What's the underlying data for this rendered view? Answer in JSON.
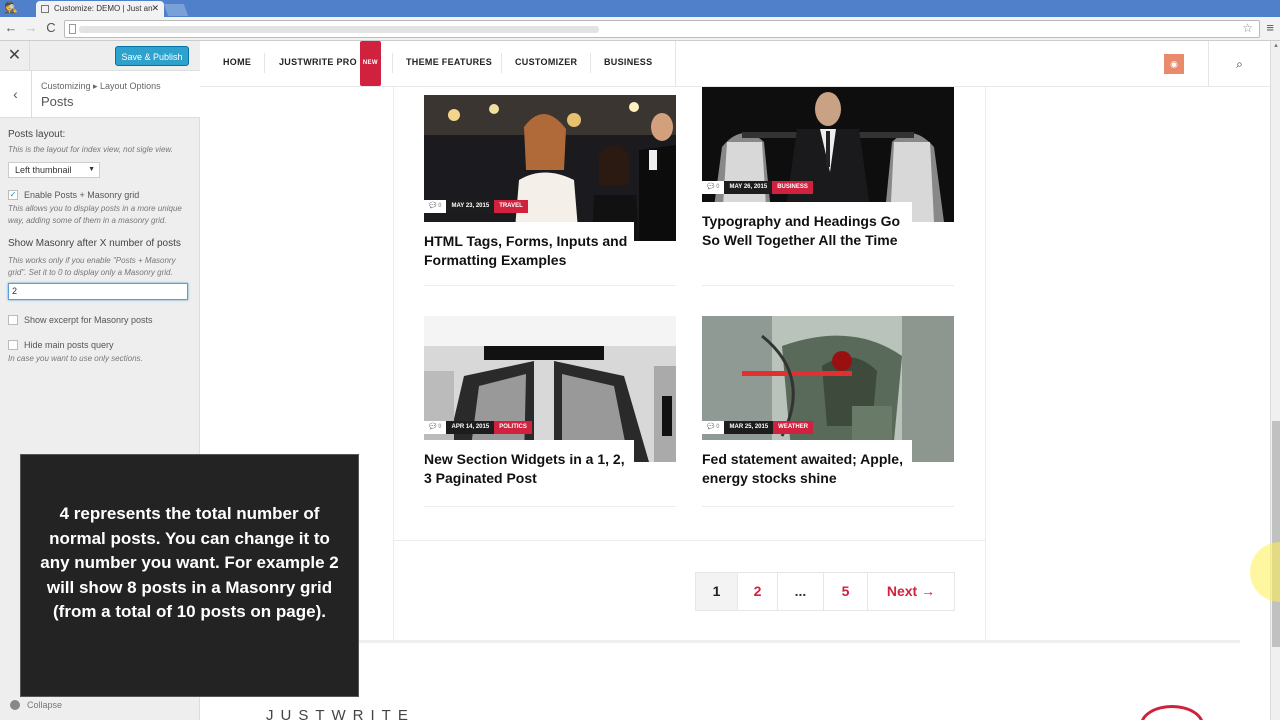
{
  "browser": {
    "tab_title": "Customize: DEMO | Just an",
    "tab_close": "✕",
    "logo": "🕵",
    "back": "←",
    "forward": "→",
    "reload": "C",
    "star": "☆",
    "menu": "≡"
  },
  "customizer": {
    "close_icon": "✕",
    "save_label": "Save & Publish",
    "back_icon": "‹",
    "breadcrumb": "Customizing ▸ Layout Options",
    "section_title": "Posts",
    "posts_layout_label": "Posts layout:",
    "posts_layout_desc": "This is the layout for index view, not sigle view.",
    "posts_layout_value": "Left thumbnail",
    "select_caret": "▼",
    "masonry_check_label": "Enable Posts + Masonry grid",
    "masonry_checked_mark": "✓",
    "masonry_desc": "This allows you to display posts in a more unique way, adding some of them in a masonry grid.",
    "masonry_after_label": "Show Masonry after X number of posts",
    "masonry_after_desc": "This works only if you enable \"Posts + Masonry grid\". Set it to 0 to display only a Masonry grid.",
    "masonry_after_value": "2",
    "excerpt_label": "Show excerpt for Masonry posts",
    "hide_main_label": "Hide main posts query",
    "hide_main_desc": "In case you want to use only sections.",
    "collapse_label": "Collapse"
  },
  "nav": {
    "items": [
      "HOME",
      "JUSTWRITE PRO",
      "THEME FEATURES",
      "CUSTOMIZER",
      "BUSINESS"
    ],
    "new_badge": "NEW",
    "rss_icon": "◉",
    "search_icon": "⌕"
  },
  "posts": [
    {
      "comments": "💬 0",
      "date": "MAY 23, 2015",
      "category": "TRAVEL",
      "title": "HTML Tags, Forms, Inputs and Formatting Examples"
    },
    {
      "comments": "💬 0",
      "date": "MAY 26, 2015",
      "category": "BUSINESS",
      "title": "Typography and Headings Go So Well Together All the Time"
    },
    {
      "comments": "💬 0",
      "date": "APR 14, 2015",
      "category": "POLITICS",
      "title": "New Section Widgets in a 1, 2, 3 Paginated Post"
    },
    {
      "comments": "💬 0",
      "date": "MAR 25, 2015",
      "category": "WEATHER",
      "title": "Fed statement awaited; Apple, energy stocks shine"
    }
  ],
  "pagination": {
    "current": "1",
    "page2": "2",
    "ellipsis": "...",
    "last": "5",
    "next": "Next →"
  },
  "footer": {
    "logo_text": "JUSTWRITE"
  },
  "overlay": {
    "caption": "4 represents the total number of normal posts. You can change it to any number you want. For example 2 will show 8 posts in a Masonry grid (from a total of 10 posts on page)."
  },
  "colors": {
    "accent": "#d0213f",
    "customizer_button": "#2ea2cc",
    "rss": "#ea8a6c",
    "browser_chrome": "#4f80c9"
  }
}
